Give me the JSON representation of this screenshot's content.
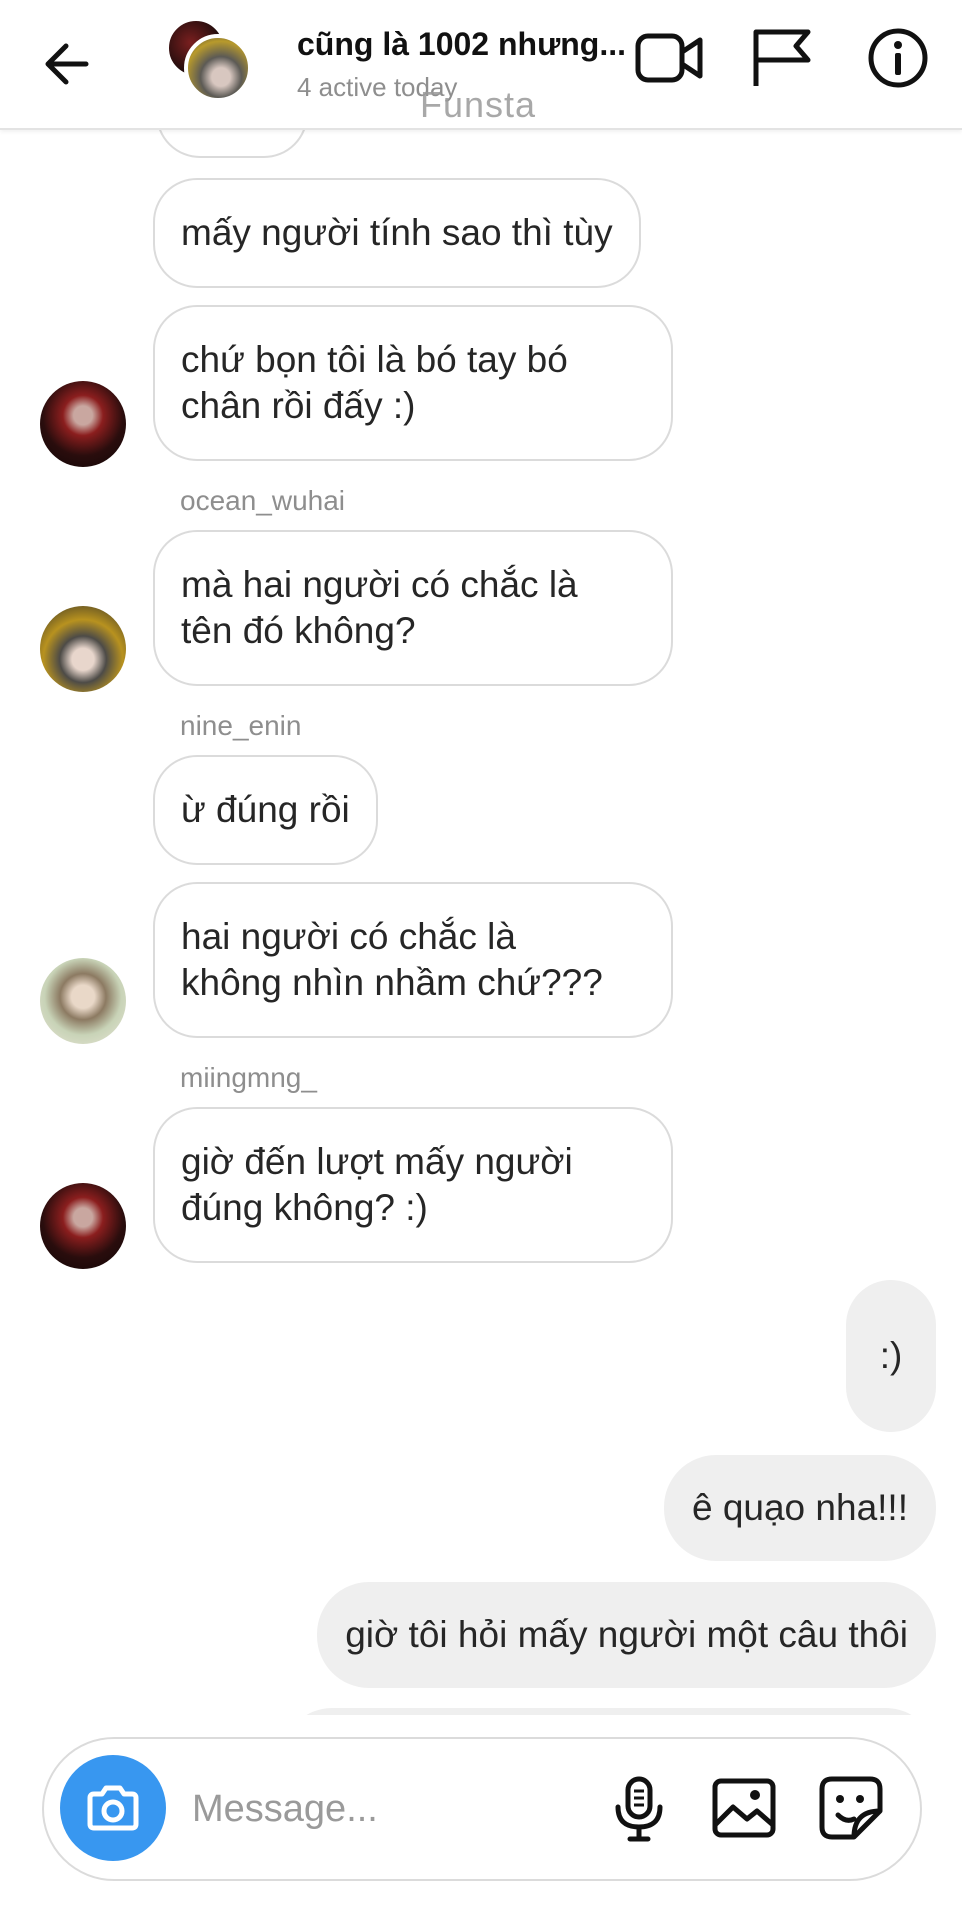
{
  "header": {
    "title": "cũng là 1002 nhưng...",
    "subtitle": "4 active today",
    "watermark": "Funsta",
    "icons": [
      "back-arrow-icon",
      "video-icon",
      "flag-icon",
      "info-icon"
    ]
  },
  "messages": {
    "m1": "mấy người tính sao thì tùy",
    "m2_l1": "chứ bọn tôi là bó tay bó",
    "m2_l2": "chân rồi đấy :)",
    "sender_ocean": "ocean_wuhai",
    "m3_l1": "mà hai người có chắc là",
    "m3_l2": "tên đó không?",
    "sender_nine": "nine_enin",
    "m4": "ừ đúng rồi",
    "m5_l1": "hai người có chắc là",
    "m5_l2": "không nhìn nhầm chứ???",
    "sender_miing": "miingmng_",
    "m6_l1": "giờ đến lượt mấy người",
    "m6_l2": "đúng không? :)",
    "out1": ":)",
    "out2": "ê quạo nha!!!",
    "out3": "giờ tôi hỏi mấy người một câu thôi"
  },
  "composer": {
    "placeholder": "Message...",
    "camera_icon": "camera-icon",
    "mic_icon": "microphone-icon",
    "gallery_icon": "gallery-icon",
    "sticker_icon": "sticker-icon",
    "accent_color": "#3897f0"
  }
}
